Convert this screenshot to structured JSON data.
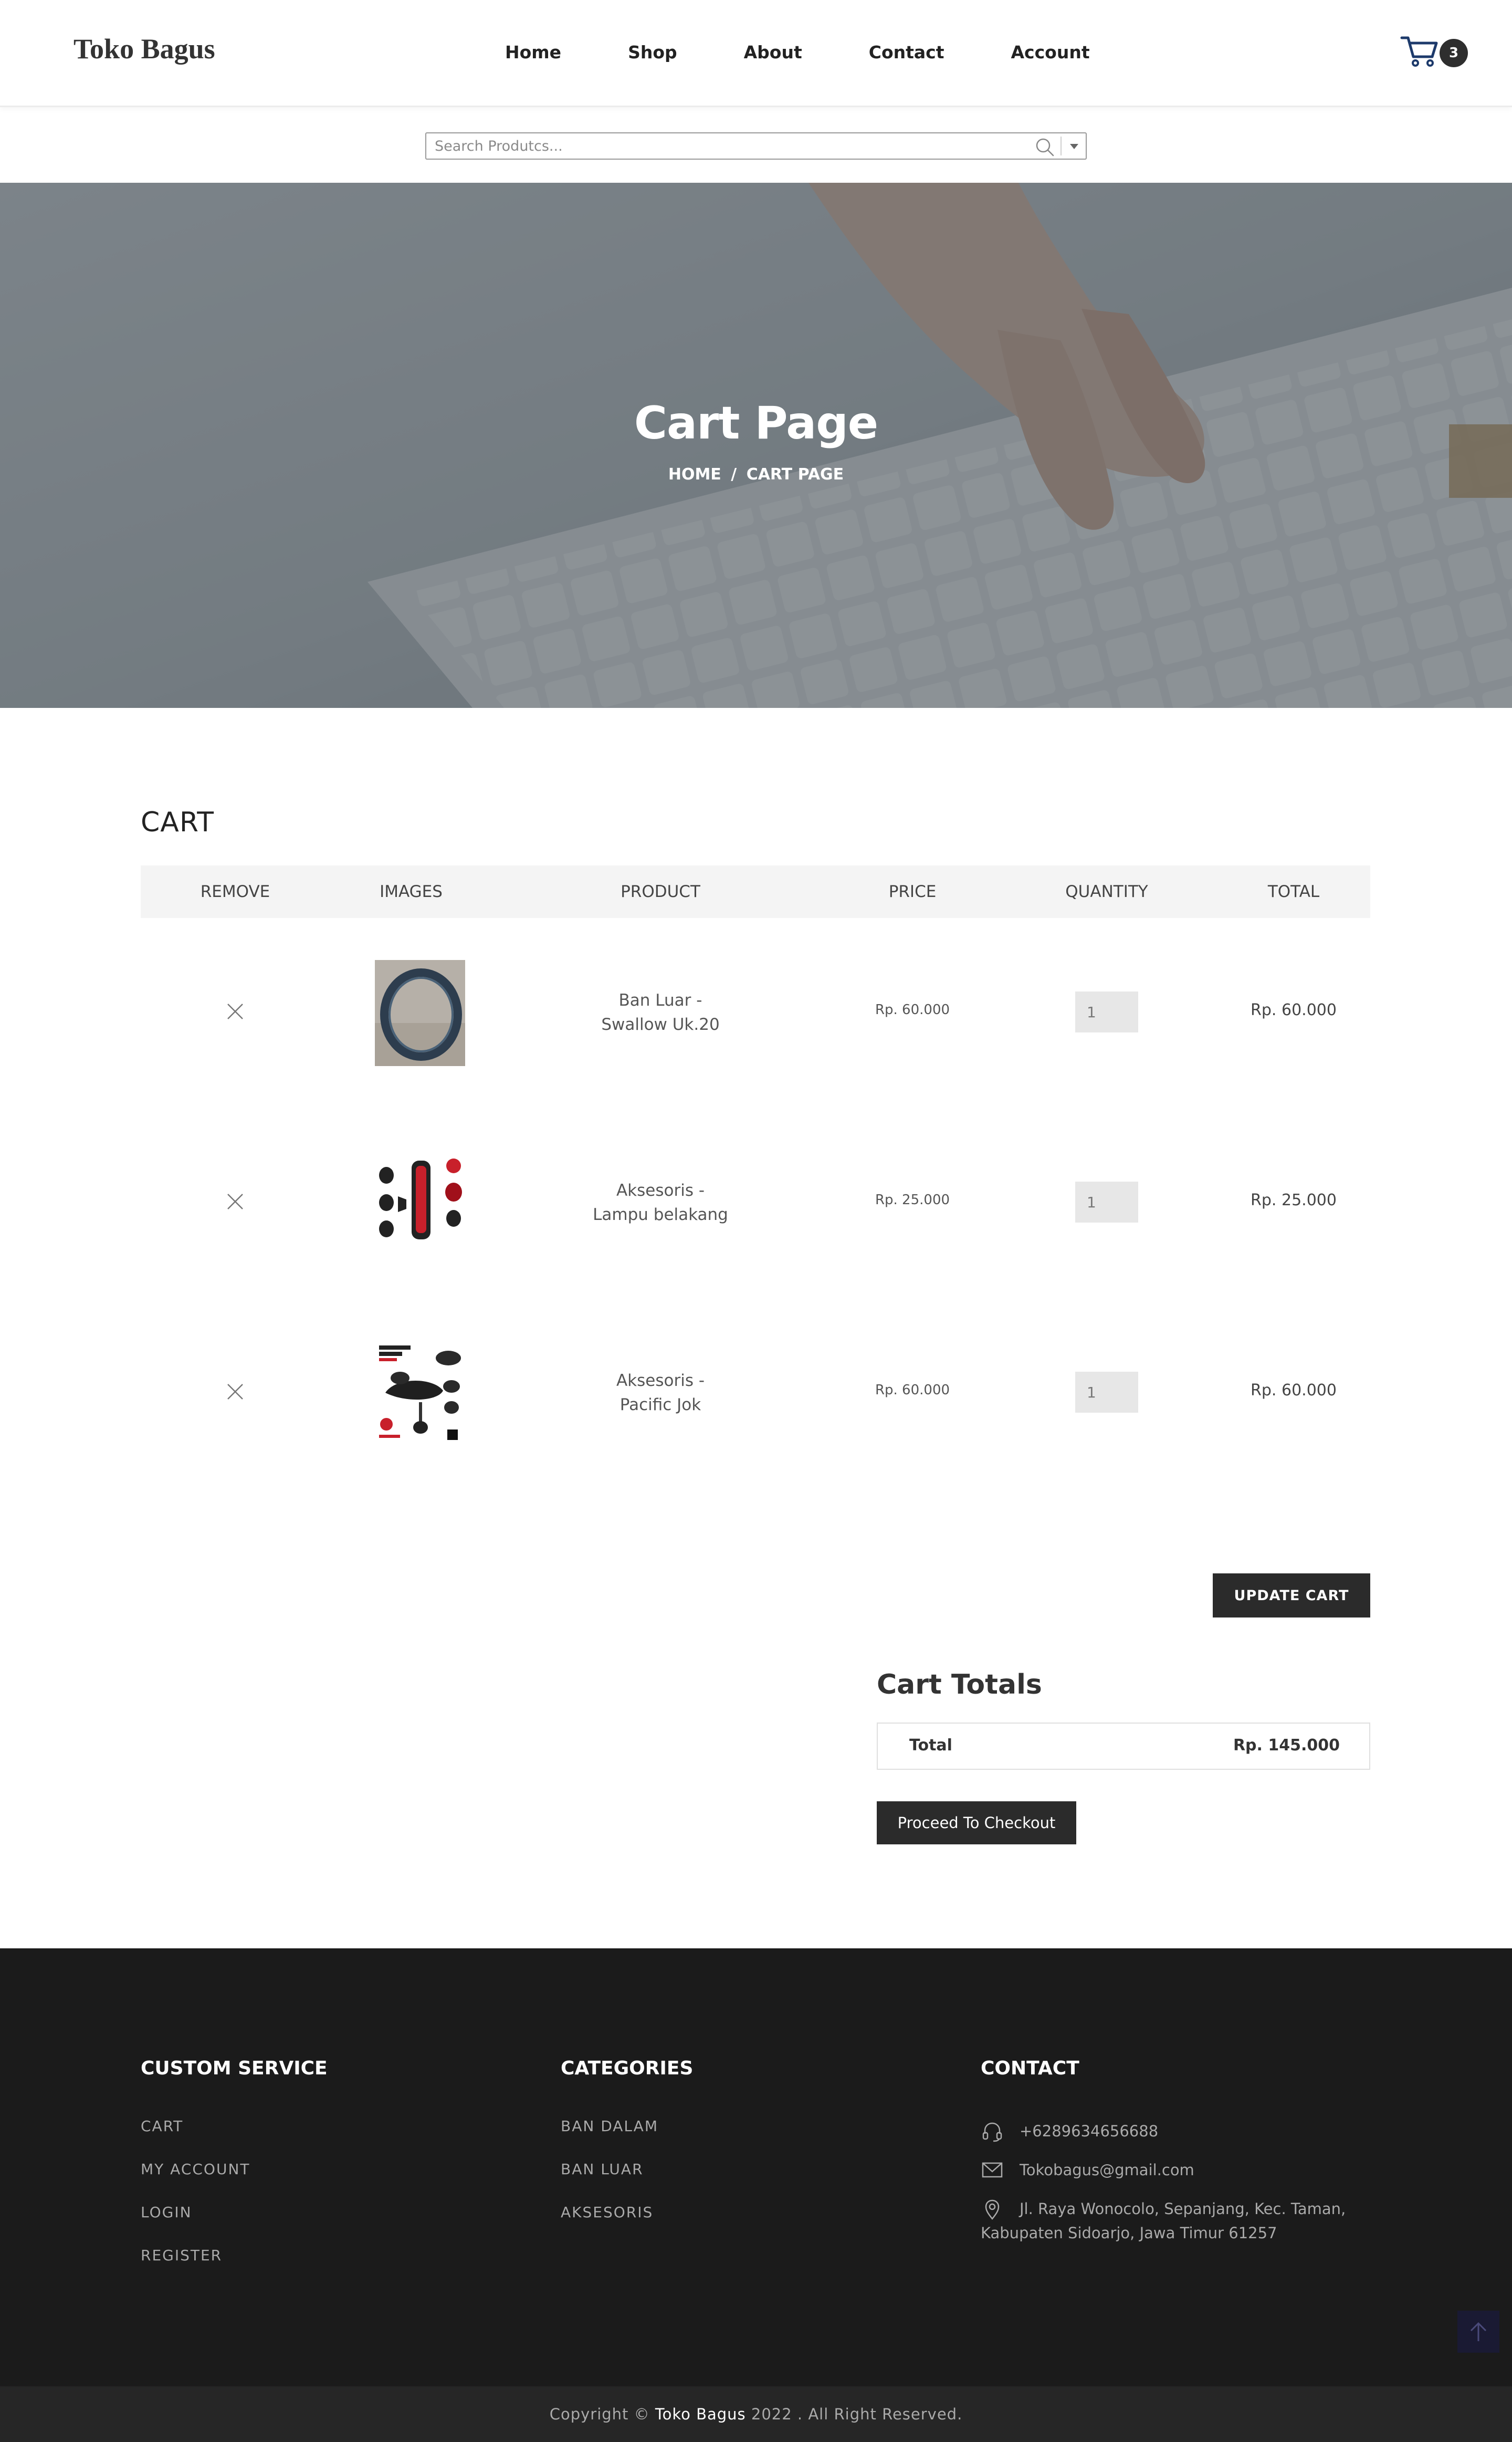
{
  "header": {
    "logo": "Toko Bagus",
    "nav": [
      "Home",
      "Shop",
      "About",
      "Contact",
      "Account"
    ],
    "cart_count": "3"
  },
  "search": {
    "placeholder": "Search Produtcs...",
    "value": ""
  },
  "hero": {
    "title": "Cart Page",
    "breadcrumb_home": "HOME",
    "breadcrumb_separator": "/",
    "breadcrumb_current": "CART PAGE"
  },
  "cart": {
    "heading": "CART",
    "columns": [
      "REMOVE",
      "IMAGES",
      "PRODUCT",
      "PRICE",
      "QUANTITY",
      "TOTAL"
    ],
    "items": [
      {
        "product_line1": "Ban Luar -",
        "product_line2": "Swallow Uk.20",
        "price": "Rp. 60.000",
        "quantity": "1",
        "total": "Rp. 60.000"
      },
      {
        "product_line1": "Aksesoris -",
        "product_line2": "Lampu belakang",
        "price": "Rp. 25.000",
        "quantity": "1",
        "total": "Rp. 25.000"
      },
      {
        "product_line1": "Aksesoris -",
        "product_line2": "Pacific Jok",
        "price": "Rp. 60.000",
        "quantity": "1",
        "total": "Rp. 60.000"
      }
    ],
    "update_button": "UPDATE CART"
  },
  "totals": {
    "heading": "Cart Totals",
    "label": "Total",
    "value": "Rp. 145.000",
    "checkout_button": "Proceed To Checkout"
  },
  "footer": {
    "service_title": "CUSTOM SERVICE",
    "service_links": [
      "CART",
      "MY ACCOUNT",
      "LOGIN",
      "REGISTER"
    ],
    "categories_title": "CATEGORIES",
    "category_links": [
      "BAN DALAM",
      "BAN LUAR",
      "AKSESORIS"
    ],
    "contact_title": "CONTACT",
    "phone": "+6289634656688",
    "email": "Tokobagus@gmail.com",
    "address": "Jl. Raya Wonocolo, Sepanjang, Kec. Taman, Kabupaten Sidoarjo, Jawa Timur 61257",
    "copyright_prefix": "Copyright ©",
    "copyright_brand": "Toko Bagus",
    "copyright_suffix": "2022 . All Right Reserved."
  },
  "icons": {
    "cart": "cart-icon",
    "search": "search-icon",
    "remove": "close-icon",
    "phone": "headset-icon",
    "email": "envelope-icon",
    "address": "map-pin-icon",
    "back_to_top": "arrow-up-icon"
  },
  "colors": {
    "accent_blue": "#1d3a6b",
    "dark_button": "#2b2b2b",
    "footer_bg": "#1b1b1b",
    "table_header_bg": "#f4f4f4"
  }
}
